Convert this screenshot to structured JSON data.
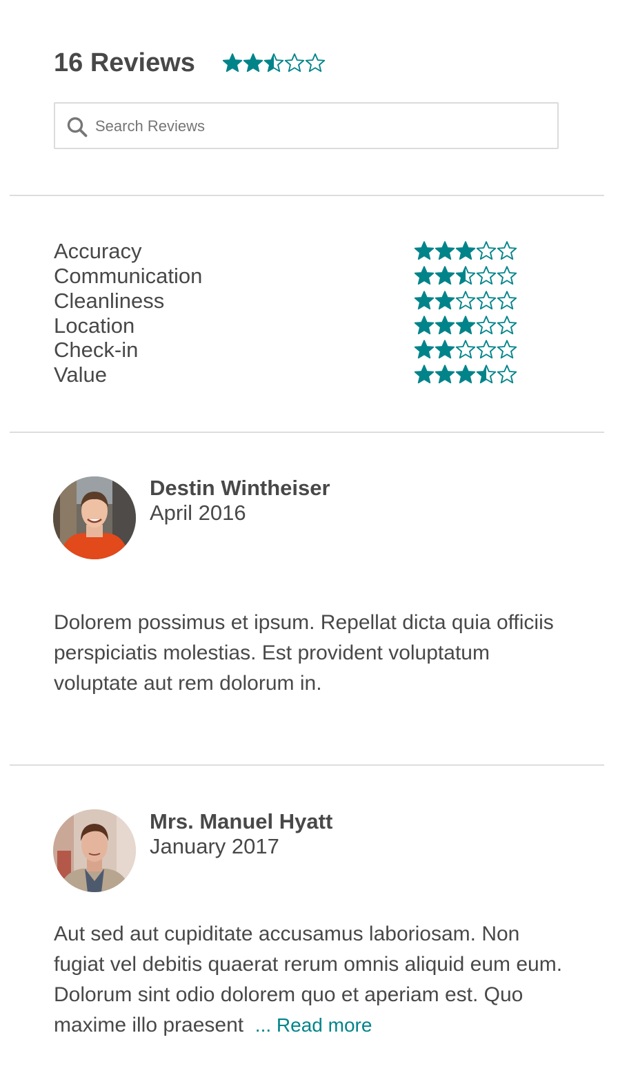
{
  "summary": {
    "title": "16 Reviews",
    "overall_rating": 2.5,
    "rating_max": 5
  },
  "search": {
    "placeholder": "Search Reviews",
    "value": ""
  },
  "categories": [
    {
      "label": "Accuracy",
      "rating": 3
    },
    {
      "label": "Communication",
      "rating": 2.5
    },
    {
      "label": "Cleanliness",
      "rating": 2
    },
    {
      "label": "Location",
      "rating": 3
    },
    {
      "label": "Check-in",
      "rating": 2
    },
    {
      "label": "Value",
      "rating": 3.5
    }
  ],
  "reviews": [
    {
      "name": "Destin Wintheiser",
      "date": "April 2016",
      "text": "Dolorem possimus et ipsum. Repellat dicta quia officiis perspiciatis molestias. Est provident voluptatum voluptate aut rem dolorum in.",
      "avatar": "avatar-photo-orange-sweater"
    },
    {
      "name": "Mrs. Manuel Hyatt",
      "date": "January 2017",
      "text": "Aut sed aut cupiditate accusamus laboriosam. Non fugiat vel debitis quaerat rerum omnis aliquid eum eum. Dolorum sint odio dolorem quo et aperiam est. Quo maxime illo praesent",
      "read_more": "... Read more",
      "avatar": "avatar-photo-brown-hair"
    }
  ],
  "colors": {
    "accent": "#00848a",
    "text": "#484848",
    "divider": "#dddddd",
    "input_border": "#dbdbdb"
  },
  "icons": {
    "search": "search-icon",
    "star_full": "star-filled-icon",
    "star_half": "star-half-icon",
    "star_empty": "star-outline-icon"
  }
}
